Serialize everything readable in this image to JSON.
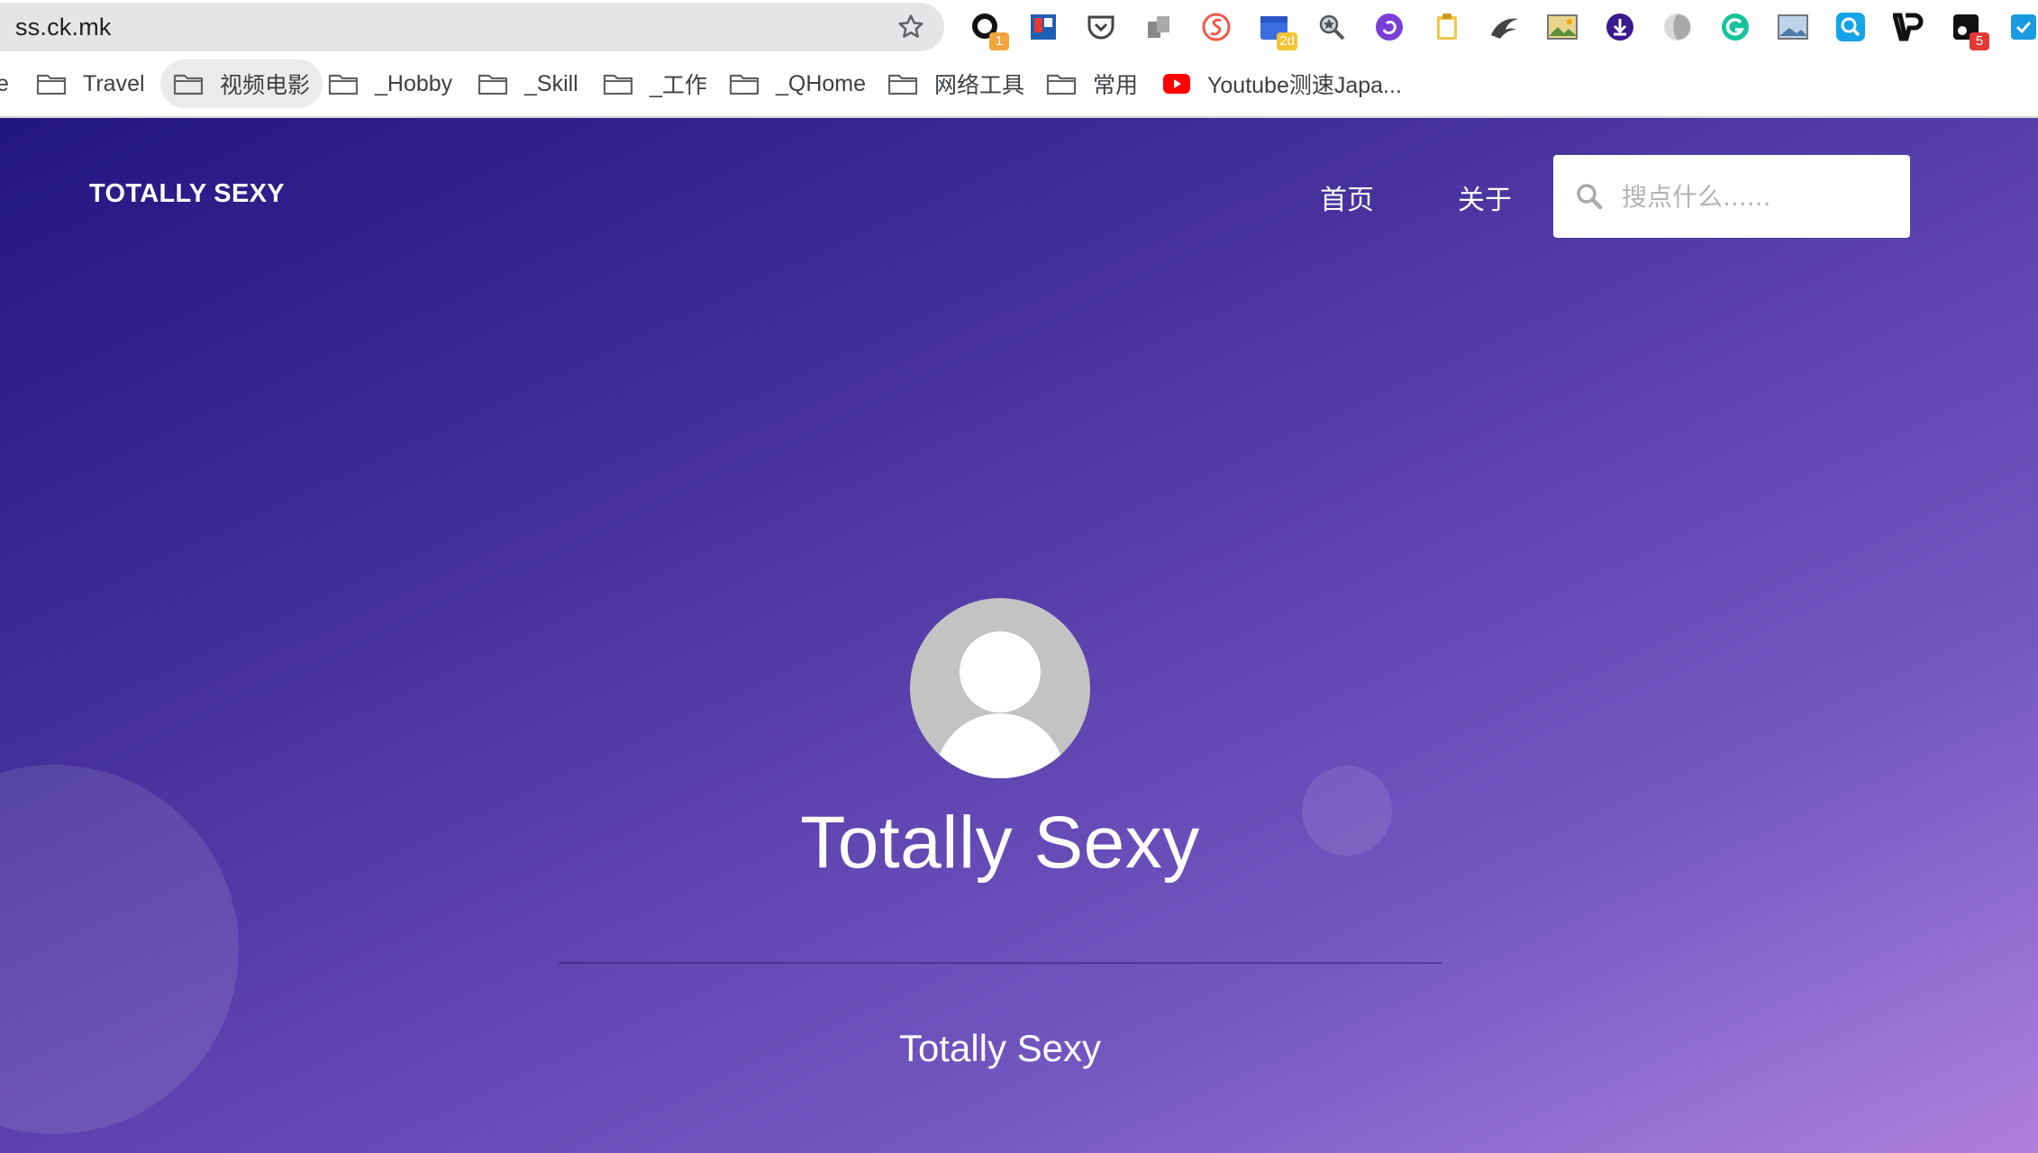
{
  "browser": {
    "url": "ss.ck.mk",
    "extensions": [
      {
        "name": "ext-o-icon",
        "badge": "1",
        "badge_color": "#f2a33a"
      },
      {
        "name": "ext-trello-icon",
        "badge": "",
        "badge_color": ""
      },
      {
        "name": "ext-pocket-icon",
        "badge": "",
        "badge_color": ""
      },
      {
        "name": "ext-copy-icon",
        "badge": "",
        "badge_color": ""
      },
      {
        "name": "ext-shield-s-icon",
        "badge": "",
        "badge_color": ""
      },
      {
        "name": "ext-calendar-icon",
        "badge": "2d",
        "badge_color": "#f5c431"
      },
      {
        "name": "ext-magnifier-star-icon",
        "badge": "",
        "badge_color": ""
      },
      {
        "name": "ext-purple-circle-icon",
        "badge": "",
        "badge_color": ""
      },
      {
        "name": "ext-clipboard-icon",
        "badge": "",
        "badge_color": ""
      },
      {
        "name": "ext-bird-icon",
        "badge": "",
        "badge_color": ""
      },
      {
        "name": "ext-image-icon",
        "badge": "",
        "badge_color": ""
      },
      {
        "name": "ext-download-icon",
        "badge": "",
        "badge_color": ""
      },
      {
        "name": "ext-grey-swirl-icon",
        "badge": "",
        "badge_color": ""
      },
      {
        "name": "ext-grammarly-icon",
        "badge": "",
        "badge_color": ""
      },
      {
        "name": "ext-landscape-icon",
        "badge": "",
        "badge_color": ""
      },
      {
        "name": "ext-search-blue-icon",
        "badge": "",
        "badge_color": ""
      },
      {
        "name": "ext-vp-icon",
        "badge": "",
        "badge_color": ""
      },
      {
        "name": "ext-black-square-icon",
        "badge": "5",
        "badge_color": "#e53935"
      },
      {
        "name": "ext-check-icon",
        "badge": "",
        "badge_color": ""
      }
    ],
    "bookmark_truncated": "e",
    "bookmarks": [
      {
        "label": "Travel",
        "icon": "folder-icon"
      },
      {
        "label": "视频电影",
        "icon": "folder-icon"
      },
      {
        "label": "_Hobby",
        "icon": "folder-icon"
      },
      {
        "label": "_Skill",
        "icon": "folder-icon"
      },
      {
        "label": "_工作",
        "icon": "folder-icon"
      },
      {
        "label": "_QHome",
        "icon": "folder-icon"
      },
      {
        "label": "网络工具",
        "icon": "folder-icon"
      },
      {
        "label": "常用",
        "icon": "folder-icon"
      },
      {
        "label": "Youtube测速Japa...",
        "icon": "youtube-icon"
      }
    ]
  },
  "site": {
    "brand": "TOTALLY SEXY",
    "nav": [
      {
        "label": "首页"
      },
      {
        "label": "关于"
      }
    ],
    "search": {
      "placeholder": "搜点什么......",
      "value": ""
    },
    "title": "Totally Sexy",
    "subtitle": "Totally Sexy"
  },
  "colors": {
    "gradient_start": "#241681",
    "gradient_end": "#b07fdc",
    "text": "#ffffff"
  }
}
